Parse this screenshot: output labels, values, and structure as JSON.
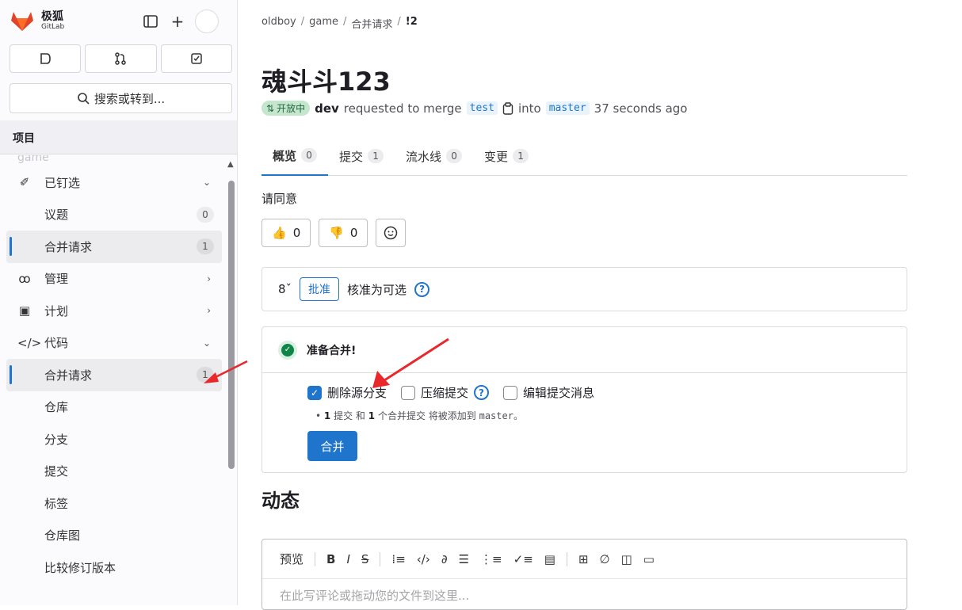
{
  "brand": {
    "name": "极狐",
    "sub": "GitLab"
  },
  "sidebar": {
    "search_label": "搜索或转到...",
    "section_title": "项目",
    "faded_item": "game",
    "items": [
      {
        "label": "已钉选",
        "icon": "pin-icon",
        "chevron": "⌄"
      },
      {
        "label": "议题",
        "count": "0"
      },
      {
        "label": "合并请求",
        "count": "1"
      },
      {
        "label": "管理",
        "icon": "users-icon",
        "chevron": "›"
      },
      {
        "label": "计划",
        "icon": "calendar-icon",
        "chevron": "›"
      },
      {
        "label": "代码",
        "icon": "code-icon",
        "chevron": "⌄"
      },
      {
        "label": "合并请求",
        "count": "1"
      },
      {
        "label": "仓库"
      },
      {
        "label": "分支"
      },
      {
        "label": "提交"
      },
      {
        "label": "标签"
      },
      {
        "label": "仓库图"
      },
      {
        "label": "比较修订版本"
      }
    ]
  },
  "breadcrumb": [
    "oldboy",
    "game",
    "合并请求",
    "!2"
  ],
  "mr": {
    "title": "魂斗斗123",
    "status": "开放中",
    "author": "dev",
    "requested_text": "requested to merge",
    "source_branch": "test",
    "into_text": "into",
    "target_branch": "master",
    "time_ago": "37 seconds ago",
    "description": "请同意"
  },
  "tabs": [
    {
      "label": "概览",
      "count": "0"
    },
    {
      "label": "提交",
      "count": "1"
    },
    {
      "label": "流水线",
      "count": "0"
    },
    {
      "label": "变更",
      "count": "1"
    }
  ],
  "reactions": {
    "thumbs_up": "0",
    "thumbs_down": "0"
  },
  "approval": {
    "button": "批准",
    "text": "核准为可选"
  },
  "merge": {
    "status": "准备合并!",
    "opt_delete": "删除源分支",
    "opt_squash": "压缩提交",
    "opt_edit": "编辑提交消息",
    "note_count1": "1",
    "note_part1": "提交 和",
    "note_count2": "1",
    "note_part2": "个合并提交 将被添加到",
    "note_branch": "master",
    "note_end": "。",
    "button": "合并"
  },
  "activity": {
    "title": "动态",
    "preview": "预览",
    "placeholder": "在此写评论或拖动您的文件到这里..."
  },
  "colors": {
    "accent": "#1f75cb",
    "arrow": "#e8282b",
    "success": "#108548"
  }
}
